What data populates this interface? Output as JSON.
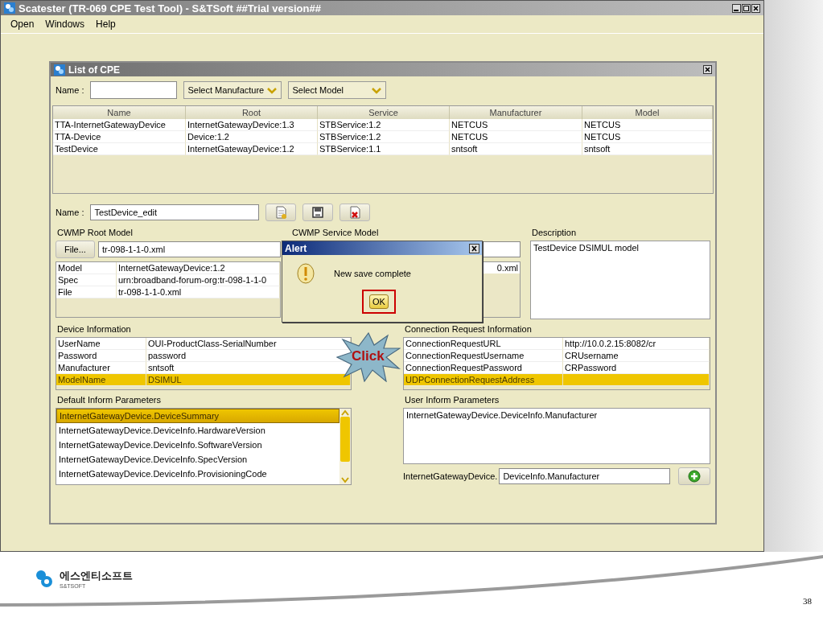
{
  "window": {
    "title": "Scatester (TR-069 CPE Test Tool) - S&TSoft ##Trial version##"
  },
  "menu": [
    "Open",
    "Windows",
    "Help"
  ],
  "cpe_list": {
    "title": "List of CPE",
    "name_label": "Name :",
    "manufacture_select": "Select Manufacture",
    "model_select": "Select Model",
    "columns": [
      "Name",
      "Root",
      "Service",
      "Manufacturer",
      "Model"
    ],
    "rows": [
      [
        "TTA-InternetGatewayDevice",
        "InternetGatewayDevice:1.3",
        "STBService:1.2",
        "NETCUS",
        "NETCUS"
      ],
      [
        "TTA-Device",
        "Device:1.2",
        "STBService:1.2",
        "NETCUS",
        "NETCUS"
      ],
      [
        "TestDevice",
        "InternetGatewayDevice:1.2",
        "STBService:1.1",
        "sntsoft",
        "sntsoft"
      ]
    ]
  },
  "editor": {
    "name_label": "Name :",
    "name_value": "TestDevice_edit",
    "root_model": {
      "title": "CWMP Root Model",
      "file_button": "File...",
      "file": "tr-098-1-1-0.xml",
      "rows": [
        [
          "Model",
          "InternetGatewayDevice:1.2"
        ],
        [
          "Spec",
          "urn:broadband-forum-org:tr-098-1-1-0"
        ],
        [
          "File",
          "tr-098-1-1-0.xml"
        ]
      ]
    },
    "service_model": {
      "title": "CWMP Service Model",
      "cell": "0.xml"
    },
    "description": {
      "title": "Description",
      "text": "TestDevice DSIMUL model"
    },
    "device_info": {
      "title": "Device Information",
      "rows": [
        {
          "cells": [
            "UserName",
            "OUI-ProductClass-SerialNumber"
          ],
          "selected": false
        },
        {
          "cells": [
            "Password",
            "password"
          ],
          "selected": false
        },
        {
          "cells": [
            "Manufacturer",
            "sntsoft"
          ],
          "selected": false
        },
        {
          "cells": [
            "ModelName",
            "DSIMUL"
          ],
          "selected": true
        }
      ]
    },
    "connection_request": {
      "title": "Connection Request Information",
      "rows": [
        {
          "cells": [
            "ConnectionRequestURL",
            "http://10.0.2.15:8082/cr"
          ],
          "selected": false
        },
        {
          "cells": [
            "ConnectionRequestUsername",
            "CRUsername"
          ],
          "selected": false
        },
        {
          "cells": [
            "ConnectionRequestPassword",
            "CRPassword"
          ],
          "selected": false
        },
        {
          "cells": [
            "UDPConnectionRequestAddress"
          ],
          "selected": true
        }
      ]
    },
    "default_inform": {
      "title": "Default Inform Parameters",
      "items": [
        {
          "label": "InternetGatewayDevice.DeviceSummary",
          "selected": true
        },
        {
          "label": "InternetGatewayDevice.DeviceInfo.HardwareVersion",
          "selected": false
        },
        {
          "label": "InternetGatewayDevice.DeviceInfo.SoftwareVersion",
          "selected": false
        },
        {
          "label": "InternetGatewayDevice.DeviceInfo.SpecVersion",
          "selected": false
        },
        {
          "label": "InternetGatewayDevice.DeviceInfo.ProvisioningCode",
          "selected": false
        }
      ]
    },
    "user_inform": {
      "title": "User Inform Parameters",
      "text": "InternetGatewayDevice.DeviceInfo.Manufacturer",
      "prefix": "InternetGatewayDevice.",
      "value": "DeviceInfo.Manufacturer"
    }
  },
  "alert": {
    "title": "Alert",
    "message": "New save complete",
    "button": "OK"
  },
  "callout": {
    "text": "Click"
  },
  "footer": {
    "company": "에스엔티소프트",
    "company_en": "S&TSOFT",
    "page": "38"
  }
}
